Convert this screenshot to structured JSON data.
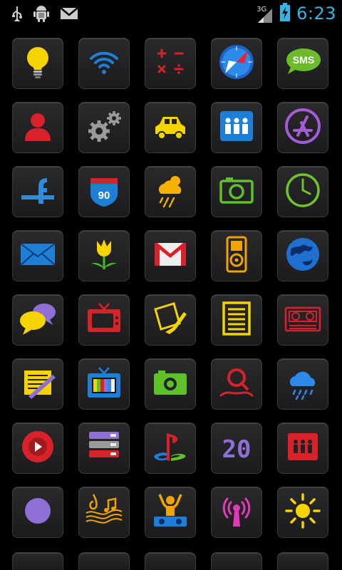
{
  "status_bar": {
    "time": "6:23",
    "network_type": "3G",
    "left_icons": [
      "usb-icon",
      "android-debug-icon",
      "gmail-notification-icon"
    ],
    "right_icons": [
      "signal-icon",
      "battery-charging-icon"
    ]
  },
  "icons": [
    "lightbulb-icon",
    "wifi-icon",
    "calculator-icon",
    "compass-icon",
    "sms-icon",
    "contacts-icon",
    "settings-gears-icon",
    "taxi-icon",
    "people-group-icon",
    "app-store-icon",
    "facebook-icon",
    "highway-90-icon",
    "weather-rain-sun-icon",
    "camera-icon",
    "clock-icon",
    "mail-icon",
    "tulip-icon",
    "gmail-icon",
    "ipod-icon",
    "globe-icon",
    "chat-bubbles-icon",
    "tv-icon",
    "photo-edit-icon",
    "notes-icon",
    "tape-player-icon",
    "notepad-pencil-icon",
    "color-tv-icon",
    "photo-camera-icon",
    "search-map-icon",
    "rain-cloud-icon",
    "play-button-icon",
    "stacked-drives-icon",
    "playstation-icon",
    "digital-20-icon",
    "elevator-people-icon",
    "purple-dot-icon",
    "music-notes-icon",
    "dj-icon",
    "broadcast-icon",
    "sun-icon"
  ],
  "icon_labels": {
    "sms": "SMS",
    "highway": "90",
    "digits": "20"
  },
  "colors": {
    "clock": "#33b5e5",
    "yellow": "#f5d400",
    "blue": "#1e7fd6",
    "red": "#d8222a"
  }
}
